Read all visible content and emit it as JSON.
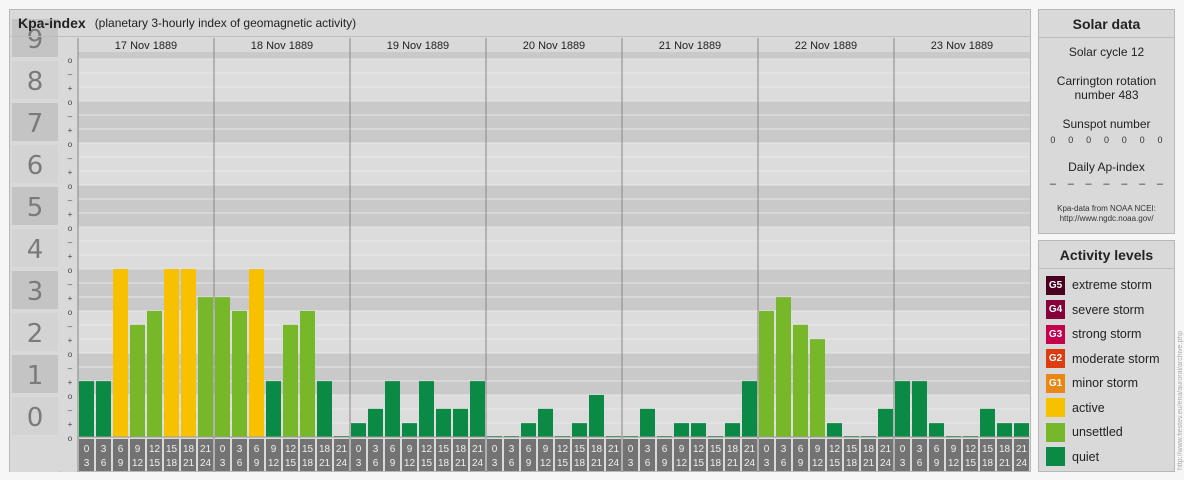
{
  "header": {
    "title": "Kpa-index",
    "subtitle": "(planetary 3-hourly index of geomagnetic activity)"
  },
  "chart_data": {
    "type": "bar",
    "y_tick_labels": [
      "0",
      "1",
      "2",
      "3",
      "4",
      "5",
      "6",
      "7",
      "8",
      "9"
    ],
    "minor_tick_labels": [
      "o",
      "+",
      "–"
    ],
    "days": [
      "17 Nov 1889",
      "18 Nov 1889",
      "19 Nov 1889",
      "20 Nov 1889",
      "21 Nov 1889",
      "22 Nov 1889",
      "23 Nov 1889"
    ],
    "interval_labels": [
      [
        "0",
        "3"
      ],
      [
        "3",
        "6"
      ],
      [
        "6",
        "9"
      ],
      [
        "9",
        "12"
      ],
      [
        "12",
        "15"
      ],
      [
        "15",
        "18"
      ],
      [
        "18",
        "21"
      ],
      [
        "21",
        "24"
      ]
    ],
    "values": [
      1.33,
      1.33,
      4.0,
      2.67,
      3.0,
      4.0,
      4.0,
      3.33,
      3.33,
      3.0,
      4.0,
      1.33,
      2.67,
      3.0,
      1.33,
      0.0,
      0.33,
      0.67,
      1.33,
      0.33,
      1.33,
      0.67,
      0.67,
      1.33,
      0.0,
      0.0,
      0.33,
      0.67,
      0.0,
      0.33,
      1.0,
      0.0,
      0.0,
      0.67,
      0.0,
      0.33,
      0.33,
      0.0,
      0.33,
      1.33,
      3.0,
      3.33,
      2.67,
      2.33,
      0.33,
      0.0,
      0.0,
      0.67,
      1.33,
      1.33,
      0.33,
      0.0,
      0.0,
      0.67,
      0.33,
      0.33
    ],
    "ylim": [
      0,
      9.33
    ],
    "level_colors": {
      "quiet": "#0a8a45",
      "unsettled": "#76b82a",
      "active": "#f8c100"
    },
    "grid": true
  },
  "solar": {
    "title": "Solar data",
    "cycle": "Solar cycle 12",
    "carrington": "Carrington rotation number 483",
    "sunspot_label": "Sunspot number",
    "sunspot_values": [
      "0",
      "0",
      "0",
      "0",
      "0",
      "0",
      "0"
    ],
    "ap_label": "Daily Ap-index",
    "ap_values": [
      "–",
      "–",
      "–",
      "–",
      "–",
      "–",
      "–"
    ],
    "source_line1": "Kpa-data from NOAA NCEI:",
    "source_line2": "http://www.ngdc.noaa.gov/"
  },
  "activity": {
    "title": "Activity levels",
    "levels": [
      {
        "badge": "G5",
        "label": "extreme storm",
        "color": "#4a0021"
      },
      {
        "badge": "G4",
        "label": "severe storm",
        "color": "#86003a"
      },
      {
        "badge": "G3",
        "label": "strong storm",
        "color": "#c5004f"
      },
      {
        "badge": "G2",
        "label": "moderate storm",
        "color": "#dd3b10"
      },
      {
        "badge": "G1",
        "label": "minor storm",
        "color": "#e98712"
      },
      {
        "badge": "",
        "label": "active",
        "color": "#f8c100"
      },
      {
        "badge": "",
        "label": "unsettled",
        "color": "#76b82a"
      },
      {
        "badge": "",
        "label": "quiet",
        "color": "#0a8a45"
      }
    ]
  },
  "credit": "http://www.fiestev.eu/eria/auroral/archive.php"
}
